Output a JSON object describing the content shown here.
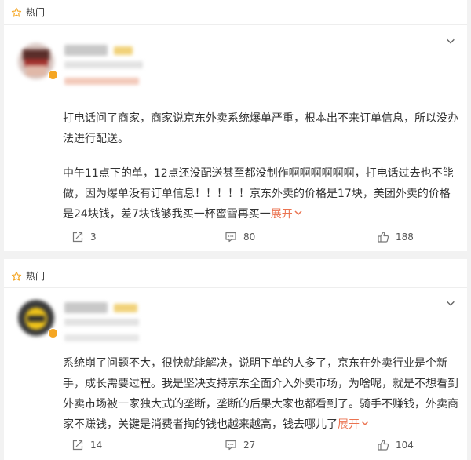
{
  "posts": [
    {
      "hot_label": "热门",
      "paragraphs": [
        "打电话问了商家，商家说京东外卖系统爆单严重，根本出不来订单信息，所以没办法进行配送。",
        "中午11点下的单，12点还没配送甚至都没制作啊啊啊啊啊啊，打电话过去也不能做，因为爆单没有订单信息！！！！！京东外卖的价格是17块，美团外卖的价格是24块钱，差7块钱够我买一杯蜜雪再买一"
      ],
      "expand_label": "展开",
      "repost_count": "3",
      "comment_count": "80",
      "like_count": "188"
    },
    {
      "hot_label": "热门",
      "paragraphs": [
        "系统崩了问题不大，很快就能解决，说明下单的人多了，京东在外卖行业是个新手，成长需要过程。我是坚决支持京东全面介入外卖市场，为啥呢，就是不想看到外卖市场被一家独大式的垄断，垄断的后果大家也都看到了。骑手不赚钱，外卖商家不赚钱，关键是消费者掏的钱也越来越高，钱去哪儿了"
      ],
      "expand_label": "展开",
      "repost_count": "14",
      "comment_count": "27",
      "like_count": "104"
    }
  ],
  "colors": {
    "hot_star": "#f5a623",
    "expand": "#eb7350",
    "page_bg": "#f2f2f2"
  },
  "icons": [
    "star-icon",
    "chevron-down-icon",
    "repost-icon",
    "comment-icon",
    "like-icon"
  ]
}
